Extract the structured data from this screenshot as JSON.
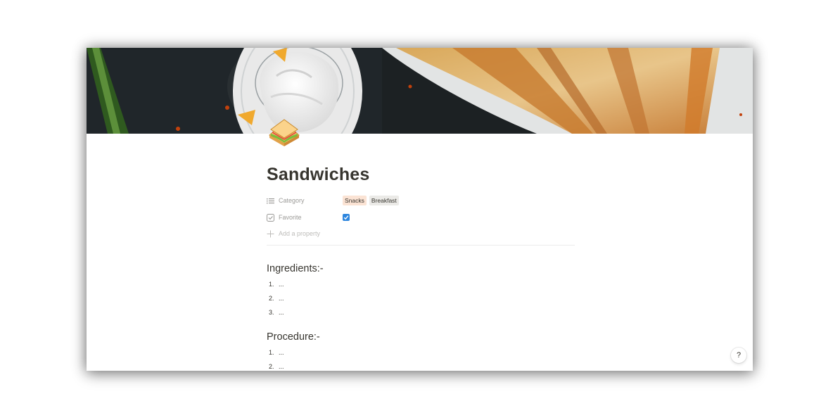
{
  "page": {
    "title": "Sandwiches",
    "icon": "sandwich-emoji-icon",
    "cover": "sandwich-photo-cover"
  },
  "properties": [
    {
      "name": "Category",
      "icon": "list-icon",
      "tags": [
        "Snacks",
        "Breakfast"
      ]
    },
    {
      "name": "Favorite",
      "icon": "checkbox-property-icon",
      "checked": true
    }
  ],
  "add_property_label": "Add a property",
  "sections": [
    {
      "heading": "Ingredients:-",
      "items": [
        {
          "num": "1.",
          "text": "..."
        },
        {
          "num": "2.",
          "text": "..."
        },
        {
          "num": "3.",
          "text": "..."
        }
      ]
    },
    {
      "heading": "Procedure:-",
      "items": [
        {
          "num": "1.",
          "text": "..."
        },
        {
          "num": "2.",
          "text": "..."
        }
      ]
    }
  ],
  "help_label": "?",
  "colors": {
    "text": "#37352f",
    "muted": "#9b9a97",
    "tag_snacks": "#fbe3d4",
    "tag_breakfast": "#ebeae7",
    "checkbox": "#2e86de"
  }
}
